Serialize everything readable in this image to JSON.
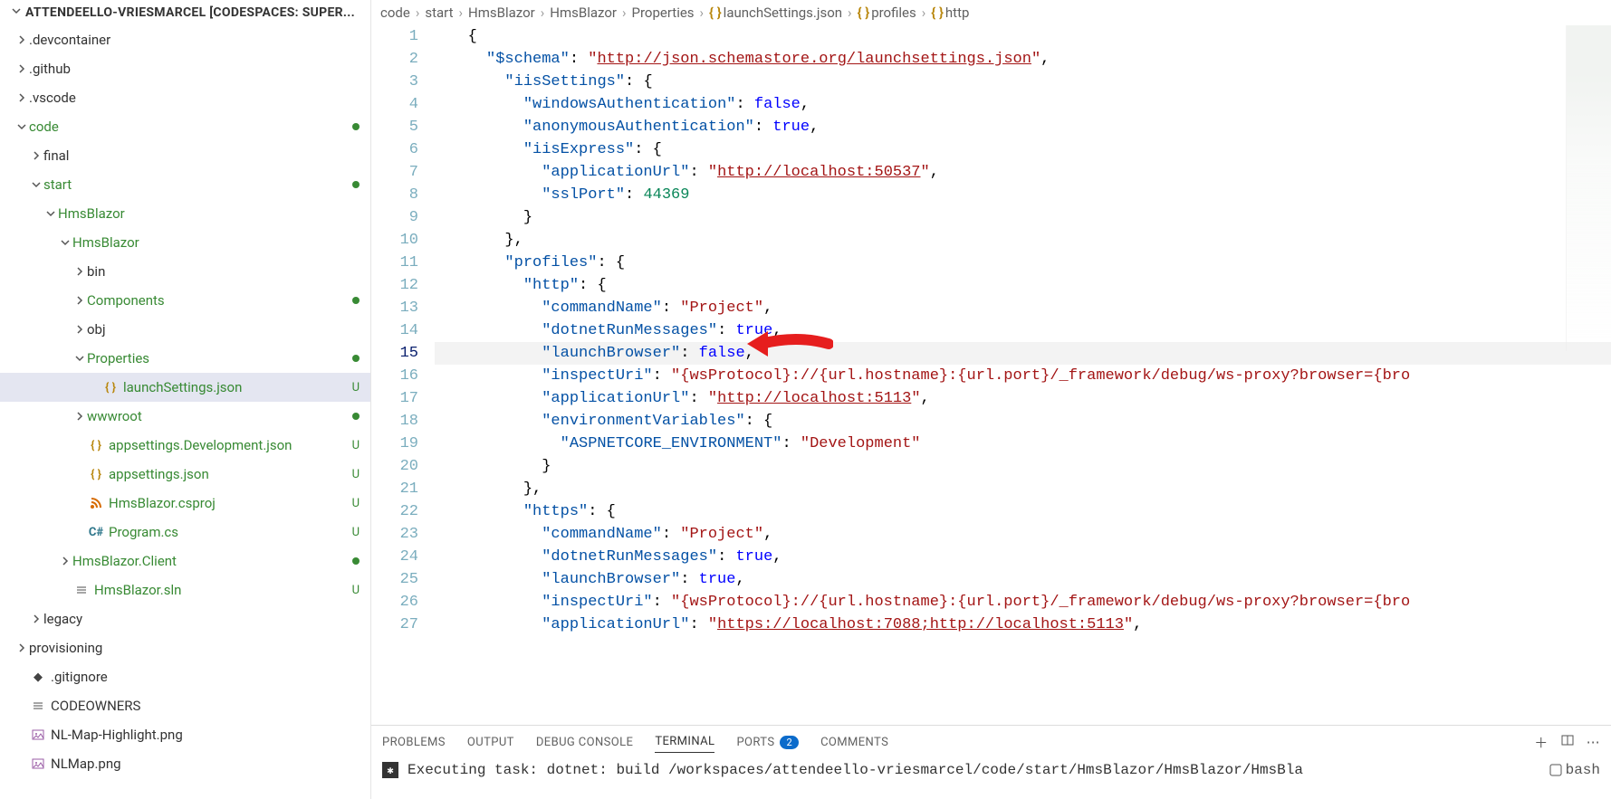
{
  "sidebar": {
    "title": "ATTENDEELLO-VRIESMARCEL [CODESPACES: SUPER...",
    "tree": [
      {
        "indent": 1,
        "chev": "right",
        "label": ".devcontainer",
        "type": "folder"
      },
      {
        "indent": 1,
        "chev": "right",
        "label": ".github",
        "type": "folder"
      },
      {
        "indent": 1,
        "chev": "right",
        "label": ".vscode",
        "type": "folder"
      },
      {
        "indent": 1,
        "chev": "down",
        "label": "code",
        "type": "folder",
        "green": true,
        "dot": true
      },
      {
        "indent": 2,
        "chev": "right",
        "label": "final",
        "type": "folder"
      },
      {
        "indent": 2,
        "chev": "down",
        "label": "start",
        "type": "folder",
        "green": true,
        "dot": true
      },
      {
        "indent": 3,
        "chev": "down",
        "label": "HmsBlazor",
        "type": "folder",
        "green": true
      },
      {
        "indent": 4,
        "chev": "down",
        "label": "HmsBlazor",
        "type": "folder",
        "green": true
      },
      {
        "indent": 5,
        "chev": "right",
        "label": "bin",
        "type": "folder"
      },
      {
        "indent": 5,
        "chev": "right",
        "label": "Components",
        "type": "folder",
        "green": true,
        "dot": true
      },
      {
        "indent": 5,
        "chev": "right",
        "label": "obj",
        "type": "folder"
      },
      {
        "indent": 5,
        "chev": "down",
        "label": "Properties",
        "type": "folder",
        "green": true,
        "dot": true
      },
      {
        "indent": 6,
        "icon": "json",
        "label": "launchSettings.json",
        "type": "file",
        "green": true,
        "selected": true,
        "status": "U"
      },
      {
        "indent": 5,
        "chev": "right",
        "label": "wwwroot",
        "type": "folder",
        "green": true,
        "dot": true
      },
      {
        "indent": 5,
        "icon": "json",
        "label": "appsettings.Development.json",
        "type": "file",
        "green": true,
        "status": "U"
      },
      {
        "indent": 5,
        "icon": "json",
        "label": "appsettings.json",
        "type": "file",
        "green": true,
        "status": "U"
      },
      {
        "indent": 5,
        "icon": "rss",
        "label": "HmsBlazor.csproj",
        "type": "file",
        "green": true,
        "status": "U"
      },
      {
        "indent": 5,
        "icon": "cs",
        "label": "Program.cs",
        "type": "file",
        "green": true,
        "status": "U"
      },
      {
        "indent": 4,
        "chev": "right",
        "label": "HmsBlazor.Client",
        "type": "folder",
        "green": true,
        "dot": true
      },
      {
        "indent": 4,
        "icon": "sln",
        "label": "HmsBlazor.sln",
        "type": "file",
        "green": true,
        "status": "U"
      },
      {
        "indent": 2,
        "chev": "right",
        "label": "legacy",
        "type": "folder"
      },
      {
        "indent": 1,
        "chev": "right",
        "label": "provisioning",
        "type": "folder"
      },
      {
        "indent": 1,
        "icon": "git",
        "label": ".gitignore",
        "type": "file"
      },
      {
        "indent": 1,
        "icon": "sln",
        "label": "CODEOWNERS",
        "type": "file"
      },
      {
        "indent": 1,
        "icon": "img",
        "label": "NL-Map-Highlight.png",
        "type": "file"
      },
      {
        "indent": 1,
        "icon": "img",
        "label": "NLMap.png",
        "type": "file"
      }
    ]
  },
  "breadcrumb": [
    "code",
    "start",
    "HmsBlazor",
    "HmsBlazor",
    "Properties",
    "launchSettings.json",
    "profiles",
    "http"
  ],
  "editor": {
    "active_line": 15,
    "lines": [
      {
        "n": 1,
        "tokens": [
          [
            "   ",
            "punc"
          ],
          [
            "{",
            "punc"
          ]
        ]
      },
      {
        "n": 2,
        "tokens": [
          [
            "     ",
            "punc"
          ],
          [
            "\"$schema\"",
            "prop"
          ],
          [
            ": ",
            "punc"
          ],
          [
            "\"",
            "str"
          ],
          [
            "http://json.schemastore.org/launchsettings.json",
            "str link"
          ],
          [
            "\"",
            "str"
          ],
          [
            ",",
            "punc"
          ]
        ]
      },
      {
        "n": 3,
        "tokens": [
          [
            "       ",
            "punc"
          ],
          [
            "\"iisSettings\"",
            "prop"
          ],
          [
            ": {",
            "punc"
          ]
        ]
      },
      {
        "n": 4,
        "tokens": [
          [
            "         ",
            "punc"
          ],
          [
            "\"windowsAuthentication\"",
            "prop"
          ],
          [
            ": ",
            "punc"
          ],
          [
            "false",
            "bool"
          ],
          [
            ",",
            "punc"
          ]
        ]
      },
      {
        "n": 5,
        "tokens": [
          [
            "         ",
            "punc"
          ],
          [
            "\"anonymousAuthentication\"",
            "prop"
          ],
          [
            ": ",
            "punc"
          ],
          [
            "true",
            "bool"
          ],
          [
            ",",
            "punc"
          ]
        ]
      },
      {
        "n": 6,
        "tokens": [
          [
            "         ",
            "punc"
          ],
          [
            "\"iisExpress\"",
            "prop"
          ],
          [
            ": {",
            "punc"
          ]
        ]
      },
      {
        "n": 7,
        "tokens": [
          [
            "           ",
            "punc"
          ],
          [
            "\"applicationUrl\"",
            "prop"
          ],
          [
            ": ",
            "punc"
          ],
          [
            "\"",
            "str"
          ],
          [
            "http://localhost:50537",
            "str link"
          ],
          [
            "\"",
            "str"
          ],
          [
            ",",
            "punc"
          ]
        ]
      },
      {
        "n": 8,
        "tokens": [
          [
            "           ",
            "punc"
          ],
          [
            "\"sslPort\"",
            "prop"
          ],
          [
            ": ",
            "punc"
          ],
          [
            "44369",
            "num"
          ]
        ]
      },
      {
        "n": 9,
        "tokens": [
          [
            "         ",
            "punc"
          ],
          [
            "}",
            "punc"
          ]
        ]
      },
      {
        "n": 10,
        "tokens": [
          [
            "       ",
            "punc"
          ],
          [
            "},",
            "punc"
          ]
        ]
      },
      {
        "n": 11,
        "tokens": [
          [
            "       ",
            "punc"
          ],
          [
            "\"profiles\"",
            "prop"
          ],
          [
            ": {",
            "punc"
          ]
        ]
      },
      {
        "n": 12,
        "tokens": [
          [
            "         ",
            "punc"
          ],
          [
            "\"http\"",
            "prop"
          ],
          [
            ": {",
            "punc"
          ]
        ]
      },
      {
        "n": 13,
        "tokens": [
          [
            "           ",
            "punc"
          ],
          [
            "\"commandName\"",
            "prop"
          ],
          [
            ": ",
            "punc"
          ],
          [
            "\"Project\"",
            "str"
          ],
          [
            ",",
            "punc"
          ]
        ]
      },
      {
        "n": 14,
        "tokens": [
          [
            "           ",
            "punc"
          ],
          [
            "\"dotnetRunMessages\"",
            "prop"
          ],
          [
            ": ",
            "punc"
          ],
          [
            "true",
            "bool"
          ],
          [
            ",",
            "punc"
          ]
        ]
      },
      {
        "n": 15,
        "tokens": [
          [
            "           ",
            "punc"
          ],
          [
            "\"launchBrowser\"",
            "prop"
          ],
          [
            ": ",
            "punc"
          ],
          [
            "false",
            "bool"
          ],
          [
            ",",
            "punc"
          ]
        ],
        "hl": true
      },
      {
        "n": 16,
        "tokens": [
          [
            "           ",
            "punc"
          ],
          [
            "\"inspectUri\"",
            "prop"
          ],
          [
            ": ",
            "punc"
          ],
          [
            "\"{wsProtocol}://{url.hostname}:{url.port}/_framework/debug/ws-proxy?browser={bro",
            "str"
          ]
        ]
      },
      {
        "n": 17,
        "tokens": [
          [
            "           ",
            "punc"
          ],
          [
            "\"applicationUrl\"",
            "prop"
          ],
          [
            ": ",
            "punc"
          ],
          [
            "\"",
            "str"
          ],
          [
            "http://localhost:5113",
            "str link"
          ],
          [
            "\"",
            "str"
          ],
          [
            ",",
            "punc"
          ]
        ]
      },
      {
        "n": 18,
        "tokens": [
          [
            "           ",
            "punc"
          ],
          [
            "\"environmentVariables\"",
            "prop"
          ],
          [
            ": {",
            "punc"
          ]
        ]
      },
      {
        "n": 19,
        "tokens": [
          [
            "             ",
            "punc"
          ],
          [
            "\"ASPNETCORE_ENVIRONMENT\"",
            "prop"
          ],
          [
            ": ",
            "punc"
          ],
          [
            "\"Development\"",
            "str"
          ]
        ]
      },
      {
        "n": 20,
        "tokens": [
          [
            "           ",
            "punc"
          ],
          [
            "}",
            "punc"
          ]
        ]
      },
      {
        "n": 21,
        "tokens": [
          [
            "         ",
            "punc"
          ],
          [
            "},",
            "punc"
          ]
        ]
      },
      {
        "n": 22,
        "tokens": [
          [
            "         ",
            "punc"
          ],
          [
            "\"https\"",
            "prop"
          ],
          [
            ": {",
            "punc"
          ]
        ]
      },
      {
        "n": 23,
        "tokens": [
          [
            "           ",
            "punc"
          ],
          [
            "\"commandName\"",
            "prop"
          ],
          [
            ": ",
            "punc"
          ],
          [
            "\"Project\"",
            "str"
          ],
          [
            ",",
            "punc"
          ]
        ]
      },
      {
        "n": 24,
        "tokens": [
          [
            "           ",
            "punc"
          ],
          [
            "\"dotnetRunMessages\"",
            "prop"
          ],
          [
            ": ",
            "punc"
          ],
          [
            "true",
            "bool"
          ],
          [
            ",",
            "punc"
          ]
        ]
      },
      {
        "n": 25,
        "tokens": [
          [
            "           ",
            "punc"
          ],
          [
            "\"launchBrowser\"",
            "prop"
          ],
          [
            ": ",
            "punc"
          ],
          [
            "true",
            "bool"
          ],
          [
            ",",
            "punc"
          ]
        ]
      },
      {
        "n": 26,
        "tokens": [
          [
            "           ",
            "punc"
          ],
          [
            "\"inspectUri\"",
            "prop"
          ],
          [
            ": ",
            "punc"
          ],
          [
            "\"{wsProtocol}://{url.hostname}:{url.port}/_framework/debug/ws-proxy?browser={bro",
            "str"
          ]
        ]
      },
      {
        "n": 27,
        "tokens": [
          [
            "           ",
            "punc"
          ],
          [
            "\"applicationUrl\"",
            "prop"
          ],
          [
            ": ",
            "punc"
          ],
          [
            "\"",
            "str"
          ],
          [
            "https://localhost:7088;http://localhost:5113",
            "str link"
          ],
          [
            "\"",
            "str"
          ],
          [
            ",",
            "punc"
          ]
        ]
      }
    ]
  },
  "panel": {
    "tabs": [
      "PROBLEMS",
      "OUTPUT",
      "DEBUG CONSOLE",
      "TERMINAL",
      "PORTS",
      "COMMENTS"
    ],
    "active": "TERMINAL",
    "ports_badge": "2",
    "terminal_text": "Executing task: dotnet: build /workspaces/attendeello-vriesmarcel/code/start/HmsBlazor/HmsBlazor/HmsBla",
    "shell": "bash"
  }
}
